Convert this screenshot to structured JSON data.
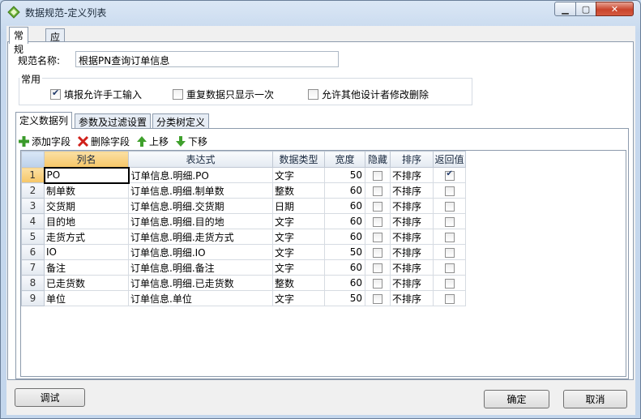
{
  "window": {
    "title": "数据规范-定义列表"
  },
  "tabs": [
    "常规",
    "应用于"
  ],
  "form": {
    "name_label": "规范名称:",
    "name_value": "根据PN查询订单信息",
    "group_title": "常用",
    "checkboxes": [
      {
        "label": "填报允许手工输入",
        "checked": true
      },
      {
        "label": "重复数据只显示一次",
        "checked": false
      },
      {
        "label": "允许其他设计者修改删除",
        "checked": false
      }
    ]
  },
  "subtabs": [
    "定义数据列",
    "参数及过滤设置",
    "分类树定义"
  ],
  "toolbar": {
    "add": "添加字段",
    "delete": "删除字段",
    "up": "上移",
    "down": "下移"
  },
  "grid": {
    "columns": [
      "列名",
      "表达式",
      "数据类型",
      "宽度",
      "隐藏",
      "排序",
      "返回值"
    ],
    "rows": [
      {
        "num": "1",
        "name": "PO",
        "expr": "订单信息.明细.PO",
        "type": "文字",
        "width": "50",
        "hidden": false,
        "sort": "不排序",
        "ret": true
      },
      {
        "num": "2",
        "name": "制单数",
        "expr": "订单信息.明细.制单数",
        "type": "整数",
        "width": "60",
        "hidden": false,
        "sort": "不排序",
        "ret": false
      },
      {
        "num": "3",
        "name": "交货期",
        "expr": "订单信息.明细.交货期",
        "type": "日期",
        "width": "60",
        "hidden": false,
        "sort": "不排序",
        "ret": false
      },
      {
        "num": "4",
        "name": "目的地",
        "expr": "订单信息.明细.目的地",
        "type": "文字",
        "width": "60",
        "hidden": false,
        "sort": "不排序",
        "ret": false
      },
      {
        "num": "5",
        "name": "走货方式",
        "expr": "订单信息.明细.走货方式",
        "type": "文字",
        "width": "60",
        "hidden": false,
        "sort": "不排序",
        "ret": false
      },
      {
        "num": "6",
        "name": "IO",
        "expr": "订单信息.明细.IO",
        "type": "文字",
        "width": "50",
        "hidden": false,
        "sort": "不排序",
        "ret": false
      },
      {
        "num": "7",
        "name": "备注",
        "expr": "订单信息.明细.备注",
        "type": "文字",
        "width": "60",
        "hidden": false,
        "sort": "不排序",
        "ret": false
      },
      {
        "num": "8",
        "name": "已走货数",
        "expr": "订单信息.明细.已走货数",
        "type": "整数",
        "width": "60",
        "hidden": false,
        "sort": "不排序",
        "ret": false
      },
      {
        "num": "9",
        "name": "单位",
        "expr": "订单信息.单位",
        "type": "文字",
        "width": "50",
        "hidden": false,
        "sort": "不排序",
        "ret": false
      }
    ]
  },
  "buttons": {
    "debug": "调试",
    "ok": "确定",
    "cancel": "取消"
  },
  "colors": {
    "add": "#3a9a2a",
    "delete": "#d0201a",
    "arrow": "#3fa02c"
  }
}
